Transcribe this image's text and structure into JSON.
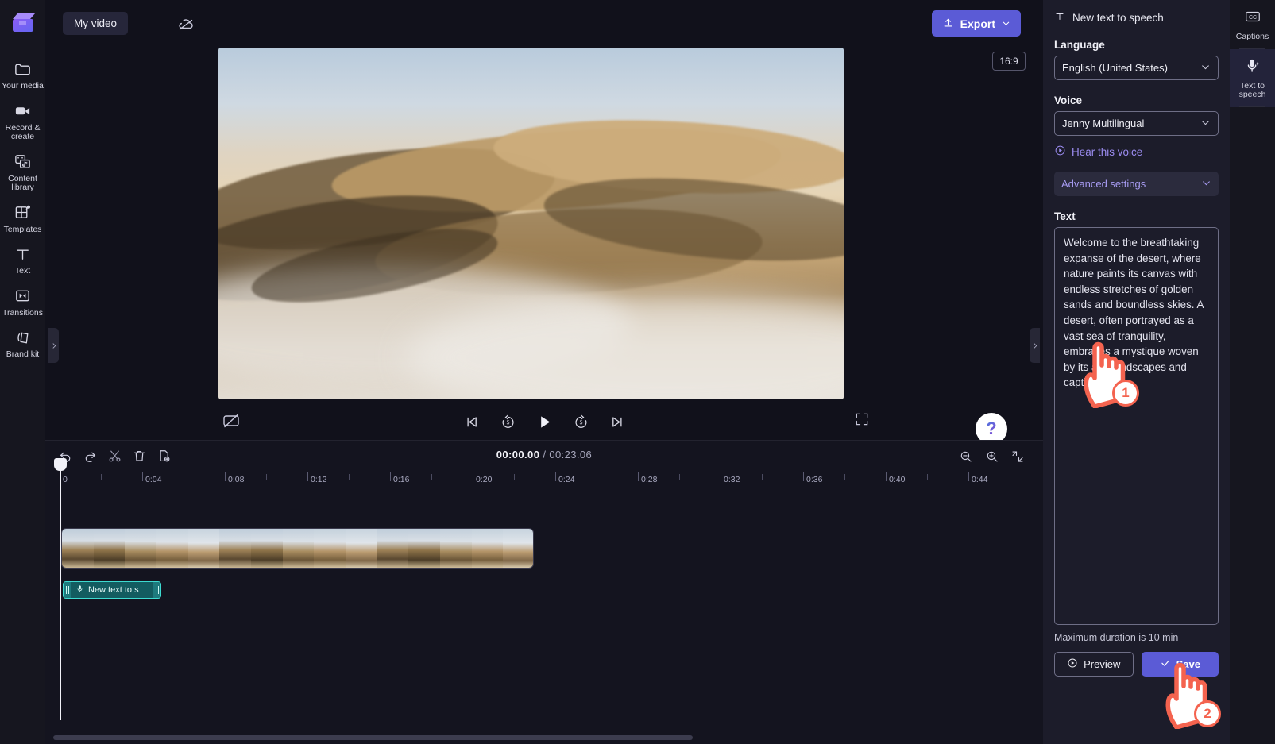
{
  "left_rail": {
    "logo_icon": "clapperboard-logo",
    "items": [
      {
        "icon": "folder-icon",
        "label": "Your media"
      },
      {
        "icon": "video-camera-icon",
        "label": "Record & create"
      },
      {
        "icon": "content-library-icon",
        "label": "Content library"
      },
      {
        "icon": "templates-icon",
        "label": "Templates"
      },
      {
        "icon": "text-icon",
        "label": "Text"
      },
      {
        "icon": "transitions-icon",
        "label": "Transitions"
      },
      {
        "icon": "brand-kit-icon",
        "label": "Brand kit"
      }
    ]
  },
  "topbar": {
    "project_name": "My video",
    "cloud_icon": "cloud-off-icon",
    "export_label": "Export",
    "export_icon": "upload-icon",
    "export_chevron": "chevron-down-icon",
    "accent_color": "#5b5bd6"
  },
  "stage": {
    "aspect_ratio": "16:9",
    "captions_toggle_icon": "captions-off-icon",
    "fullscreen_icon": "fullscreen-icon",
    "help_label": "?",
    "controls": [
      {
        "icon": "skip-previous-icon"
      },
      {
        "icon": "rewind-5-icon"
      },
      {
        "icon": "play-icon"
      },
      {
        "icon": "forward-5-icon"
      },
      {
        "icon": "skip-next-icon"
      }
    ],
    "left_collapse_icon": "chevron-right-icon",
    "right_collapse_icon": "chevron-right-icon",
    "panel_collapse_icon": "chevron-down-icon"
  },
  "timeline": {
    "tools": [
      {
        "icon": "undo-icon",
        "name": "undo"
      },
      {
        "icon": "redo-icon",
        "name": "redo"
      },
      {
        "icon": "scissors-icon",
        "name": "split"
      },
      {
        "icon": "trash-icon",
        "name": "delete"
      },
      {
        "icon": "duplicate-icon",
        "name": "duplicate"
      }
    ],
    "current_time": "00:00.00",
    "separator": "/",
    "total_time": "00:23.06",
    "zoom_out_icon": "zoom-out-icon",
    "zoom_in_icon": "zoom-in-icon",
    "fit_icon": "fit-to-timeline-icon",
    "ruler_labels": [
      "0",
      "0:04",
      "0:08",
      "0:12",
      "0:16",
      "0:20",
      "0:24",
      "0:28",
      "0:32",
      "0:36",
      "0:40",
      "0:44"
    ],
    "audio_clip_label": "New text to s",
    "audio_clip_icon": "text-to-speech-icon"
  },
  "right_panel": {
    "title": "New text to speech",
    "title_icon": "text-icon",
    "language_label": "Language",
    "language_value": "English (United States)",
    "voice_label": "Voice",
    "voice_value": "Jenny Multilingual",
    "hear_voice_label": "Hear this voice",
    "hear_voice_icon": "play-circle-icon",
    "advanced_label": "Advanced settings",
    "advanced_chevron": "chevron-down-icon",
    "text_label": "Text",
    "text_value": "Welcome to the breathtaking expanse of the desert, where nature paints its canvas with endless stretches of golden sands and boundless skies. A desert, often portrayed as a vast sea of tranquility, embraces a mystique woven by its arid landscapes and captivating",
    "duration_hint": "Maximum duration is 10 min",
    "preview_label": "Preview",
    "preview_icon": "play-circle-icon",
    "save_label": "Save",
    "save_icon": "check-icon",
    "link_color": "#9b8cf0"
  },
  "right_rail": {
    "items": [
      {
        "icon": "captions-icon",
        "label": "Captions",
        "active": false
      },
      {
        "icon": "text-to-speech-icon",
        "label": "Text to speech",
        "active": true
      }
    ]
  },
  "annotations": [
    {
      "number": "1",
      "target": "text-area"
    },
    {
      "number": "2",
      "target": "save-button"
    }
  ]
}
